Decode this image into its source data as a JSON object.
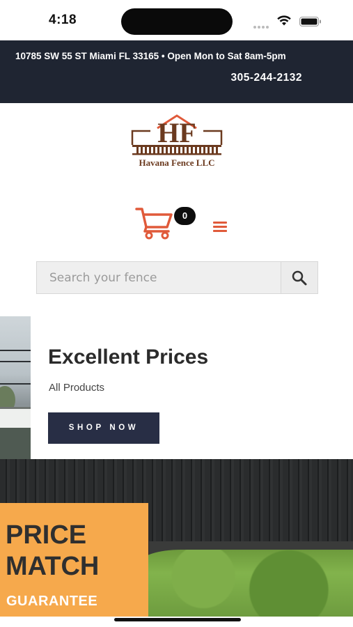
{
  "status_bar": {
    "time": "4:18"
  },
  "info_bar": {
    "address": "10785 SW 55 ST Miami FL 33165 • Open Mon to Sat 8am-5pm",
    "phone": "305-244-2132"
  },
  "logo": {
    "monogram": "HF",
    "name": "Havana Fence LLC"
  },
  "cart": {
    "count": "0",
    "icon": "cart-icon"
  },
  "menu": {
    "icon": "hamburger-menu-icon"
  },
  "search": {
    "placeholder": "Search your fence",
    "icon": "search-icon"
  },
  "hero": {
    "title": "Excellent Prices",
    "subtitle": "All Products",
    "button_label": "SHOP NOW"
  },
  "promo": {
    "line1": "PRICE",
    "line2": "MATCH",
    "line3": "GUARANTEE"
  },
  "colors": {
    "info_bar_bg": "#1f2532",
    "accent_red": "#e05a3a",
    "button_bg": "#282e45",
    "promo_orange": "#f6a94c",
    "logo_brown": "#6b3a1f"
  }
}
